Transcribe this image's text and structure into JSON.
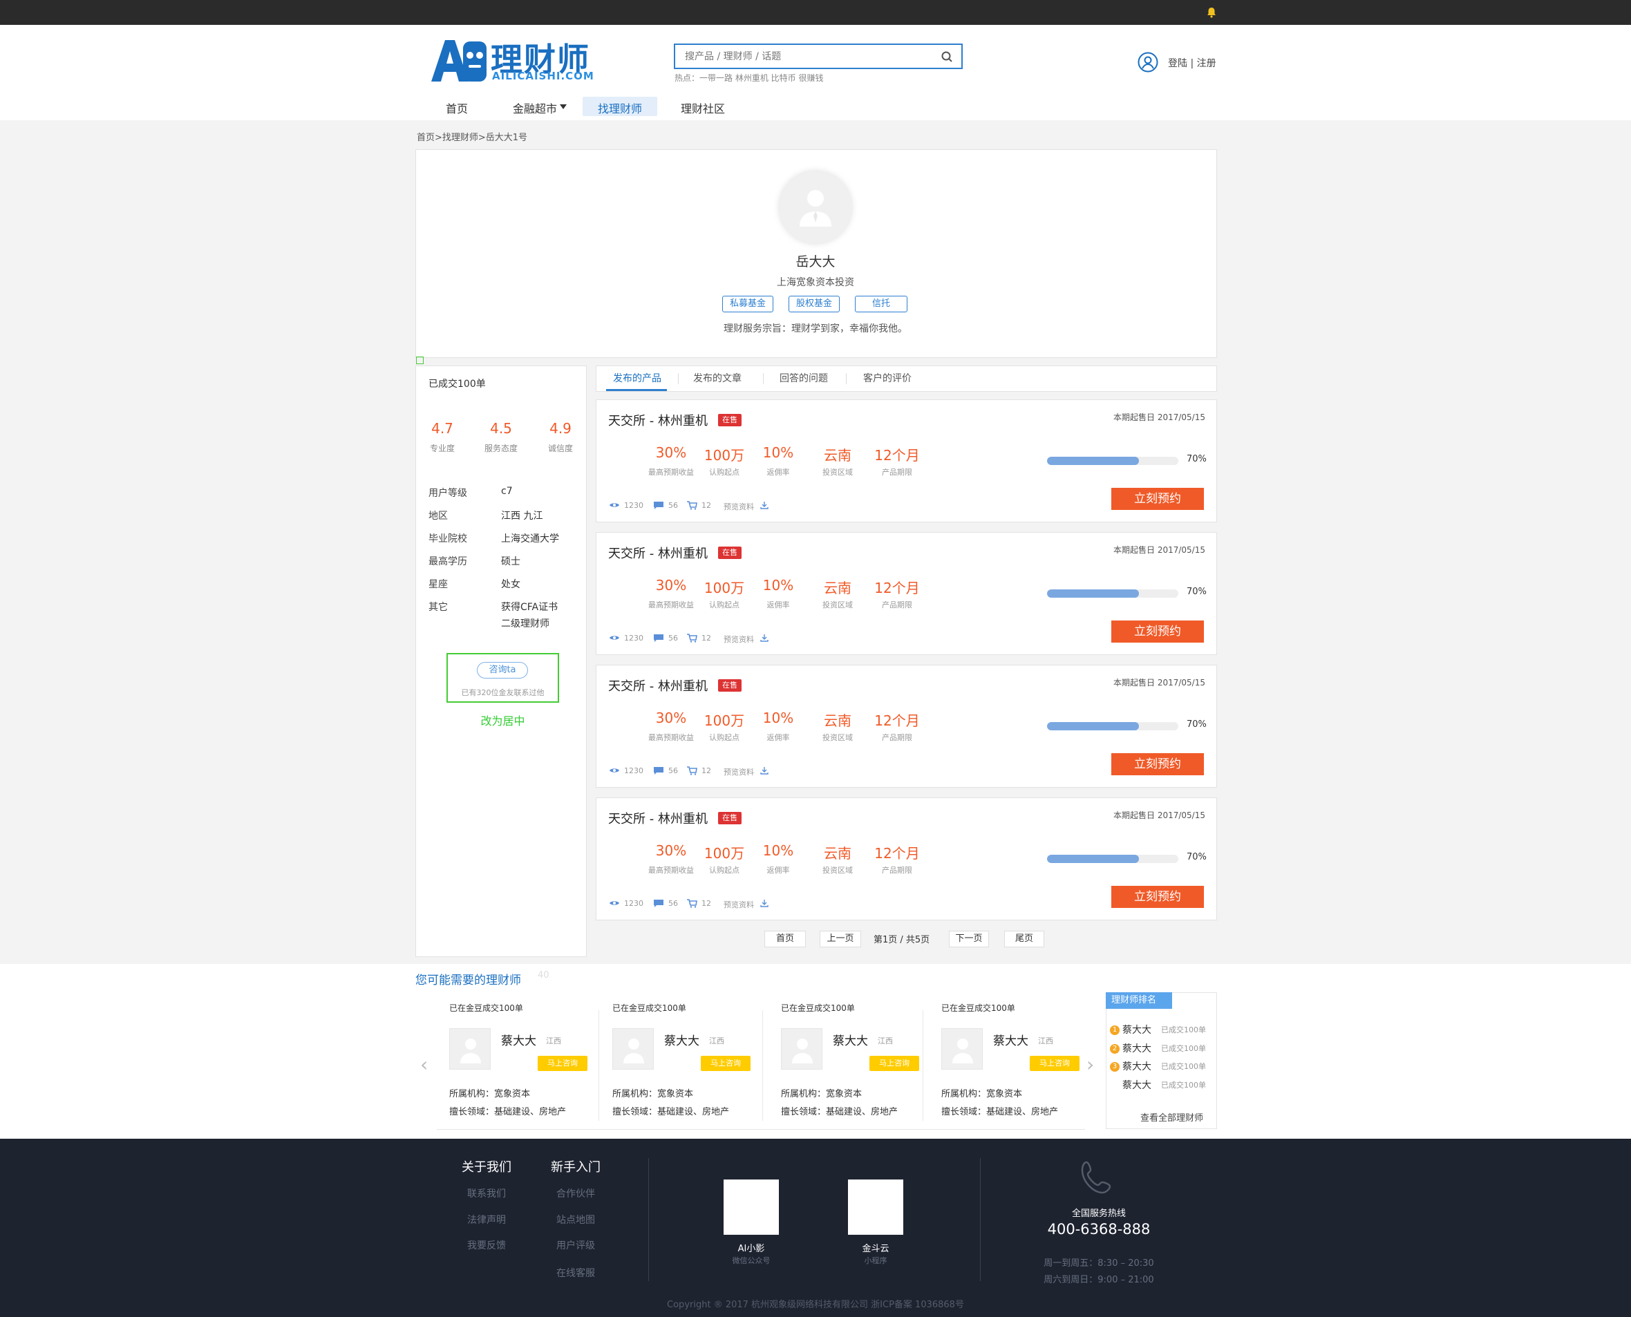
{
  "brand": {
    "logo_mark": "AI",
    "name": "理财师",
    "domain": "AILICAISHI.COM"
  },
  "search": {
    "placeholder": "搜产品 / 理财师 / 话题",
    "hot": "热点：一带一路 林州重机 比特币 很赚钱"
  },
  "auth": {
    "label": "登陆 | 注册"
  },
  "nav": [
    "首页",
    "金融超市",
    "找理财师",
    "理财社区"
  ],
  "breadcrumb": "首页>找理财师>岳大大1号",
  "profile": {
    "name": "岳大大",
    "org": "上海宽象资本投资",
    "tags": [
      "私募基金",
      "股权基金",
      "信托"
    ],
    "motto": "理财服务宗旨：理财学到家，幸福你我他。"
  },
  "sidebar": {
    "deals": "已成交100单",
    "scores": [
      {
        "value": "4.7",
        "label": "专业度"
      },
      {
        "value": "4.5",
        "label": "服务态度"
      },
      {
        "value": "4.9",
        "label": "诚信度"
      }
    ],
    "info": [
      {
        "k": "用户等级",
        "v": "c7"
      },
      {
        "k": "地区",
        "v": "江西 九江"
      },
      {
        "k": "毕业院校",
        "v": "上海交通大学"
      },
      {
        "k": "最高学历",
        "v": "硕士"
      },
      {
        "k": "星座",
        "v": "处女"
      },
      {
        "k": "其它",
        "v": "获得CFA证书",
        "v2": "二级理财师"
      }
    ],
    "consult_btn": "咨询ta",
    "consult_note": "已有320位金友联系过他",
    "annotation": "改为居中"
  },
  "tabs": [
    "发布的产品",
    "发布的文章",
    "回答的问题",
    "客户的评价"
  ],
  "product_template": {
    "title": "天交所 - 林州重机",
    "badge": "在售",
    "date": "本期起售日 2017/05/15",
    "metrics": [
      {
        "value": "30%",
        "label": "最高预期收益"
      },
      {
        "value": "100万",
        "label": "认购起点"
      },
      {
        "value": "10%",
        "label": "返佣率"
      },
      {
        "value": "云南",
        "label": "投资区域"
      },
      {
        "value": "12个月",
        "label": "产品期限"
      }
    ],
    "progress": 0.7,
    "progress_label": "70%",
    "views": "1230",
    "comments": "56",
    "carts": "12",
    "preview": "预览资料",
    "cta": "立刻预约"
  },
  "pagination": {
    "first": "首页",
    "prev": "上一页",
    "info": "第1页 / 共5页",
    "next": "下一页",
    "last": "尾页"
  },
  "recommend": {
    "title": "您可能需要的理财师",
    "faint": "40",
    "items": [
      {
        "deals": "已在金豆成交100单",
        "name": "蔡大大",
        "loc": "江西",
        "btn": "马上咨询",
        "org": "所属机构：宽象资本",
        "field": "擅长领域：基础建设、房地产"
      },
      {
        "deals": "已在金豆成交100单",
        "name": "蔡大大",
        "loc": "江西",
        "btn": "马上咨询",
        "org": "所属机构：宽象资本",
        "field": "擅长领域：基础建设、房地产"
      },
      {
        "deals": "已在金豆成交100单",
        "name": "蔡大大",
        "loc": "江西",
        "btn": "马上咨询",
        "org": "所属机构：宽象资本",
        "field": "擅长领域：基础建设、房地产"
      },
      {
        "deals": "已在金豆成交100单",
        "name": "蔡大大",
        "loc": "江西",
        "btn": "马上咨询",
        "org": "所属机构：宽象资本",
        "field": "擅长领域：基础建设、房地产"
      }
    ],
    "prev_arrow": "‹",
    "next_arrow": "›"
  },
  "ranking": {
    "title": "理财师排名",
    "rows": [
      {
        "num": "1",
        "name": "蔡大大",
        "note": "已成交100单"
      },
      {
        "num": "2",
        "name": "蔡大大",
        "note": "已成交100单"
      },
      {
        "num": "3",
        "name": "蔡大大",
        "note": "已成交100单"
      },
      {
        "num": "",
        "name": "蔡大大",
        "note": "已成交100单"
      }
    ],
    "all": "查看全部理财师"
  },
  "footer": {
    "col1": {
      "title": "关于我们",
      "links": [
        "联系我们",
        "法律声明",
        "我要反馈"
      ]
    },
    "col2": {
      "title": "新手入门",
      "links": [
        "合作伙伴",
        "站点地图",
        "用户评级",
        "在线客服"
      ]
    },
    "qr": [
      {
        "name": "AI小影",
        "sub": "微信公众号"
      },
      {
        "name": "金斗云",
        "sub": "小程序"
      }
    ],
    "hotline_label": "全国服务热线",
    "hotline": "400-6368-888",
    "hours": [
      "周一到周五：8:30 – 20:30",
      "周六到周日：9:00 – 21:00"
    ],
    "copyright": "Copyright ® 2017 杭州观象级网络科技有限公司 浙ICP备案 1036868号"
  },
  "colors": {
    "accent": "#2d7fd0",
    "orange": "#f05a28",
    "yellow": "#ffcc00",
    "footer_bg": "#1e2330"
  }
}
